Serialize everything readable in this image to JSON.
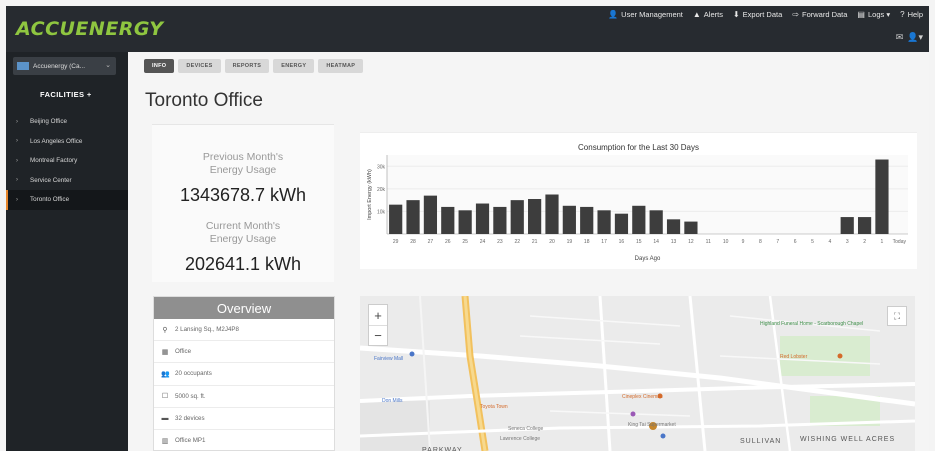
{
  "brand": {
    "logo_text": "ACCUENERGY",
    "accent": "#8fc640"
  },
  "topnav": [
    {
      "icon": "user-icon",
      "glyph": "👤",
      "label": "User Management"
    },
    {
      "icon": "alert-icon",
      "glyph": "▲",
      "label": "Alerts"
    },
    {
      "icon": "download-icon",
      "glyph": "⬇",
      "label": "Export Data"
    },
    {
      "icon": "forward-icon",
      "glyph": "⇨",
      "label": "Forward Data"
    },
    {
      "icon": "logs-icon",
      "glyph": "▤",
      "label": "Logs ▾"
    },
    {
      "icon": "help-icon",
      "glyph": "?",
      "label": "Help"
    }
  ],
  "sidebar": {
    "account_label": "Accuenergy (Ca...",
    "section_title": "FACILITIES  +",
    "items": [
      {
        "label": "Beijing Office",
        "active": false
      },
      {
        "label": "Los Angeles Office",
        "active": false
      },
      {
        "label": "Montreal Factory",
        "active": false
      },
      {
        "label": "Service Center",
        "active": false
      },
      {
        "label": "Toronto Office",
        "active": true
      }
    ]
  },
  "tabs": [
    "INFO",
    "DEVICES",
    "REPORTS",
    "ENERGY",
    "HEATMAP"
  ],
  "active_tab": "INFO",
  "page_title": "Toronto Office",
  "stats": {
    "previous_label_1": "Previous Month's",
    "previous_label_2": "Energy Usage",
    "previous_value": "1343678.7 kWh",
    "current_label_1": "Current Month's",
    "current_label_2": "Energy Usage",
    "current_value": "202641.1 kWh"
  },
  "overview": {
    "title": "Overview",
    "rows": [
      {
        "icon": "map-pin-icon",
        "glyph": "⚲",
        "text": "2 Lansing Sq., M2J4P8"
      },
      {
        "icon": "building-icon",
        "glyph": "▦",
        "text": "Office"
      },
      {
        "icon": "people-icon",
        "glyph": "👥",
        "text": "20 occupants"
      },
      {
        "icon": "area-icon",
        "glyph": "☐",
        "text": "5000 sq. ft."
      },
      {
        "icon": "devices-icon",
        "glyph": "▬",
        "text": "32 devices"
      },
      {
        "icon": "office-icon",
        "glyph": "▥",
        "text": "Office MP1"
      }
    ]
  },
  "chart_data": {
    "type": "bar",
    "title": "Consumption for the Last 30 Days",
    "xlabel": "Days Ago",
    "ylabel": "Import Energy (kWh)",
    "ylim": [
      0,
      35
    ],
    "y_ticks": [
      10,
      20,
      30
    ],
    "y_tick_labels": [
      "10k",
      "20k",
      "30k"
    ],
    "categories": [
      "29",
      "28",
      "27",
      "26",
      "25",
      "24",
      "23",
      "22",
      "21",
      "20",
      "19",
      "18",
      "17",
      "16",
      "15",
      "14",
      "13",
      "12",
      "11",
      "10",
      "9",
      "8",
      "7",
      "6",
      "5",
      "4",
      "3",
      "2",
      "1",
      "Today"
    ],
    "values": [
      13,
      15,
      17,
      12,
      10.5,
      13.5,
      12,
      15,
      15.5,
      17.5,
      12.5,
      12,
      10.5,
      9,
      12.5,
      10.5,
      6.5,
      5.5,
      0,
      0,
      0,
      0,
      0,
      0,
      0,
      0,
      7.5,
      7.5,
      33,
      0
    ],
    "color": "#3d3d3d"
  },
  "map": {
    "labels": [
      {
        "text": "Highland Funeral Home - Scarborough Chapel",
        "color": "#3f8f4a"
      },
      {
        "text": "Red Lobster",
        "color": "#d46a2a"
      },
      {
        "text": "Fairview Mall",
        "color": "#4a76c8"
      },
      {
        "text": "Don Mills",
        "color": "#4a76c8"
      },
      {
        "text": "Cineplex Cinemas",
        "color": "#d46a2a"
      },
      {
        "text": "Seneca College",
        "color": "#777777"
      },
      {
        "text": "Toyota Town",
        "color": "#d46a2a"
      },
      {
        "text": "King Tai Supermarket",
        "color": "#777777"
      },
      {
        "text": "SULLIVAN",
        "color": "#555555"
      },
      {
        "text": "WISHING WELL ACRES",
        "color": "#555555"
      },
      {
        "text": "PARKWAY",
        "color": "#555555"
      },
      {
        "text": "Lawrence College",
        "color": "#777777"
      }
    ]
  }
}
